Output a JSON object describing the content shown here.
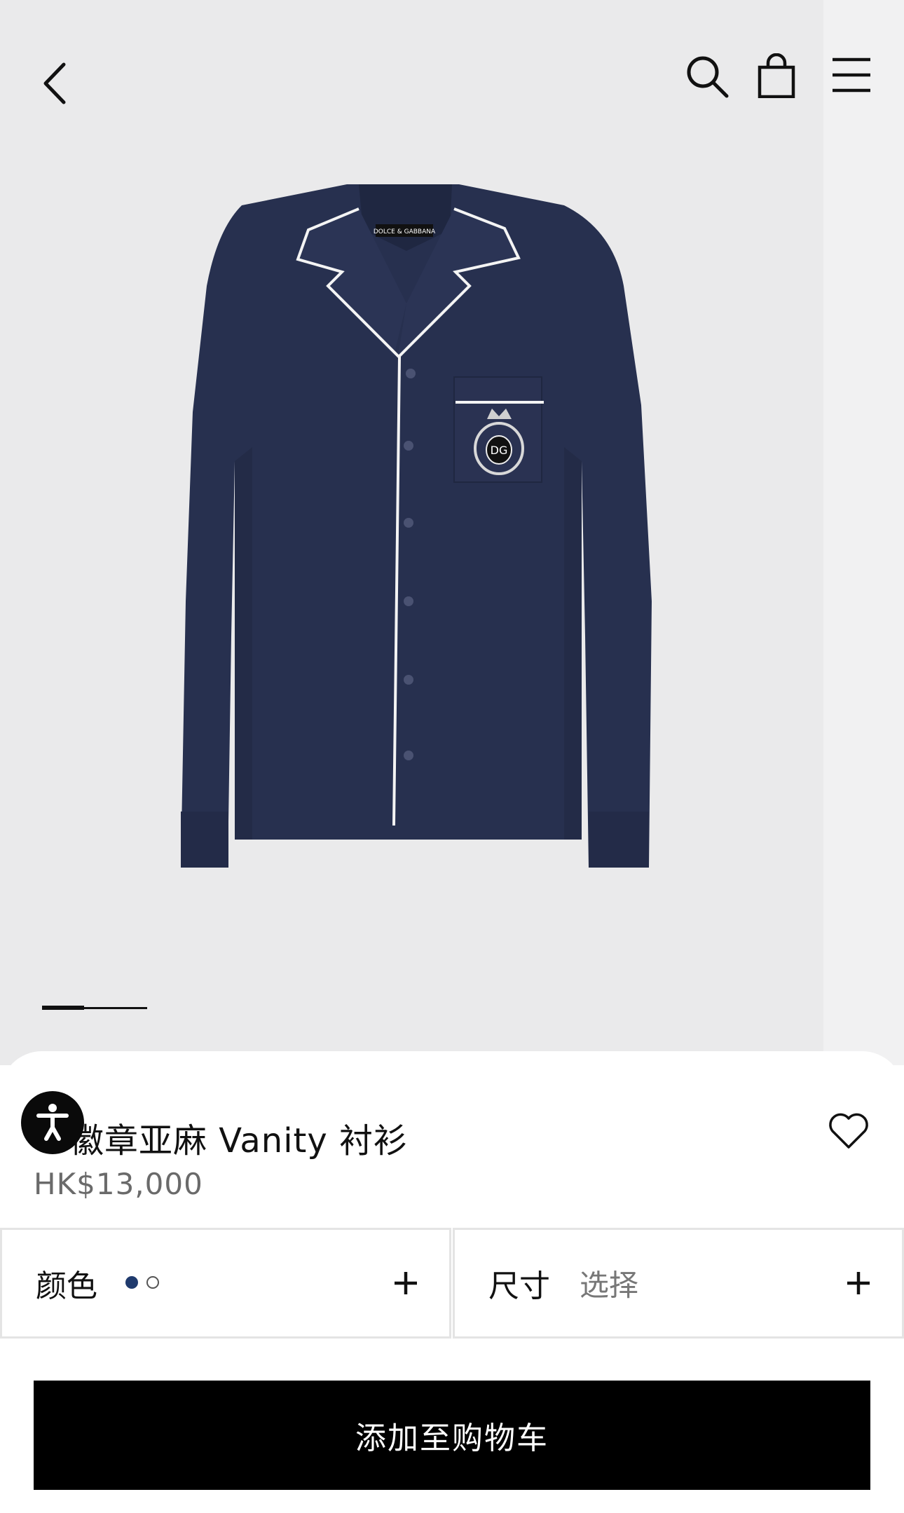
{
  "product": {
    "title": "徽章亚麻 Vanity 衬衫",
    "price": "HK$13,000",
    "label_brand": "DOLCE & GABBANA"
  },
  "carousel": {
    "current": 1,
    "total": 3
  },
  "selectors": {
    "color_label": "颜色",
    "color_options": [
      "navy",
      "white"
    ],
    "size_label": "尺寸",
    "size_value": "选择"
  },
  "actions": {
    "add_to_cart": "添加至购物车"
  },
  "icons": [
    "back-icon",
    "search-icon",
    "bag-icon",
    "menu-icon",
    "heart-icon",
    "accessibility-icon",
    "plus-icon"
  ],
  "colors": {
    "shirt": "#27304f",
    "piping": "#f4f4f4",
    "button_bg": "#000000"
  }
}
